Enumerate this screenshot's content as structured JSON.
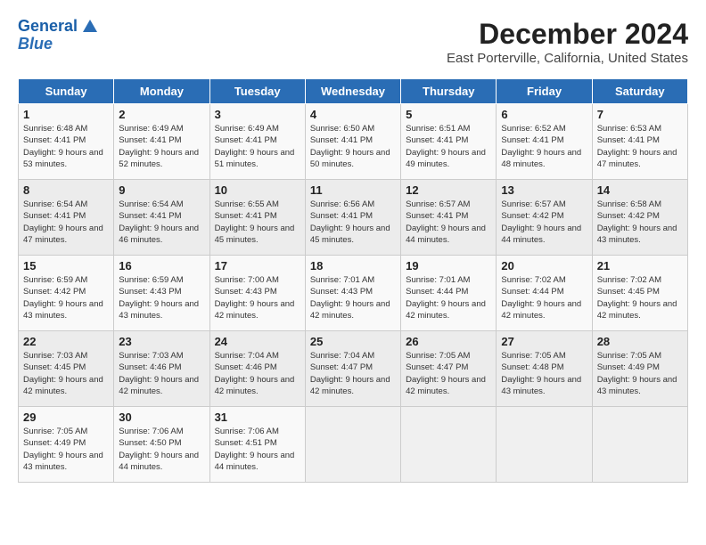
{
  "app": {
    "logo_line1": "General",
    "logo_line2": "Blue"
  },
  "calendar": {
    "title": "December 2024",
    "subtitle": "East Porterville, California, United States",
    "days_of_week": [
      "Sunday",
      "Monday",
      "Tuesday",
      "Wednesday",
      "Thursday",
      "Friday",
      "Saturday"
    ],
    "weeks": [
      [
        {
          "day": 1,
          "sunrise": "6:48 AM",
          "sunset": "4:41 PM",
          "daylight": "9 hours and 53 minutes."
        },
        {
          "day": 2,
          "sunrise": "6:49 AM",
          "sunset": "4:41 PM",
          "daylight": "9 hours and 52 minutes."
        },
        {
          "day": 3,
          "sunrise": "6:49 AM",
          "sunset": "4:41 PM",
          "daylight": "9 hours and 51 minutes."
        },
        {
          "day": 4,
          "sunrise": "6:50 AM",
          "sunset": "4:41 PM",
          "daylight": "9 hours and 50 minutes."
        },
        {
          "day": 5,
          "sunrise": "6:51 AM",
          "sunset": "4:41 PM",
          "daylight": "9 hours and 49 minutes."
        },
        {
          "day": 6,
          "sunrise": "6:52 AM",
          "sunset": "4:41 PM",
          "daylight": "9 hours and 48 minutes."
        },
        {
          "day": 7,
          "sunrise": "6:53 AM",
          "sunset": "4:41 PM",
          "daylight": "9 hours and 47 minutes."
        }
      ],
      [
        {
          "day": 8,
          "sunrise": "6:54 AM",
          "sunset": "4:41 PM",
          "daylight": "9 hours and 47 minutes."
        },
        {
          "day": 9,
          "sunrise": "6:54 AM",
          "sunset": "4:41 PM",
          "daylight": "9 hours and 46 minutes."
        },
        {
          "day": 10,
          "sunrise": "6:55 AM",
          "sunset": "4:41 PM",
          "daylight": "9 hours and 45 minutes."
        },
        {
          "day": 11,
          "sunrise": "6:56 AM",
          "sunset": "4:41 PM",
          "daylight": "9 hours and 45 minutes."
        },
        {
          "day": 12,
          "sunrise": "6:57 AM",
          "sunset": "4:41 PM",
          "daylight": "9 hours and 44 minutes."
        },
        {
          "day": 13,
          "sunrise": "6:57 AM",
          "sunset": "4:42 PM",
          "daylight": "9 hours and 44 minutes."
        },
        {
          "day": 14,
          "sunrise": "6:58 AM",
          "sunset": "4:42 PM",
          "daylight": "9 hours and 43 minutes."
        }
      ],
      [
        {
          "day": 15,
          "sunrise": "6:59 AM",
          "sunset": "4:42 PM",
          "daylight": "9 hours and 43 minutes."
        },
        {
          "day": 16,
          "sunrise": "6:59 AM",
          "sunset": "4:43 PM",
          "daylight": "9 hours and 43 minutes."
        },
        {
          "day": 17,
          "sunrise": "7:00 AM",
          "sunset": "4:43 PM",
          "daylight": "9 hours and 42 minutes."
        },
        {
          "day": 18,
          "sunrise": "7:01 AM",
          "sunset": "4:43 PM",
          "daylight": "9 hours and 42 minutes."
        },
        {
          "day": 19,
          "sunrise": "7:01 AM",
          "sunset": "4:44 PM",
          "daylight": "9 hours and 42 minutes."
        },
        {
          "day": 20,
          "sunrise": "7:02 AM",
          "sunset": "4:44 PM",
          "daylight": "9 hours and 42 minutes."
        },
        {
          "day": 21,
          "sunrise": "7:02 AM",
          "sunset": "4:45 PM",
          "daylight": "9 hours and 42 minutes."
        }
      ],
      [
        {
          "day": 22,
          "sunrise": "7:03 AM",
          "sunset": "4:45 PM",
          "daylight": "9 hours and 42 minutes."
        },
        {
          "day": 23,
          "sunrise": "7:03 AM",
          "sunset": "4:46 PM",
          "daylight": "9 hours and 42 minutes."
        },
        {
          "day": 24,
          "sunrise": "7:04 AM",
          "sunset": "4:46 PM",
          "daylight": "9 hours and 42 minutes."
        },
        {
          "day": 25,
          "sunrise": "7:04 AM",
          "sunset": "4:47 PM",
          "daylight": "9 hours and 42 minutes."
        },
        {
          "day": 26,
          "sunrise": "7:05 AM",
          "sunset": "4:47 PM",
          "daylight": "9 hours and 42 minutes."
        },
        {
          "day": 27,
          "sunrise": "7:05 AM",
          "sunset": "4:48 PM",
          "daylight": "9 hours and 43 minutes."
        },
        {
          "day": 28,
          "sunrise": "7:05 AM",
          "sunset": "4:49 PM",
          "daylight": "9 hours and 43 minutes."
        }
      ],
      [
        {
          "day": 29,
          "sunrise": "7:05 AM",
          "sunset": "4:49 PM",
          "daylight": "9 hours and 43 minutes."
        },
        {
          "day": 30,
          "sunrise": "7:06 AM",
          "sunset": "4:50 PM",
          "daylight": "9 hours and 44 minutes."
        },
        {
          "day": 31,
          "sunrise": "7:06 AM",
          "sunset": "4:51 PM",
          "daylight": "9 hours and 44 minutes."
        },
        null,
        null,
        null,
        null
      ]
    ]
  }
}
